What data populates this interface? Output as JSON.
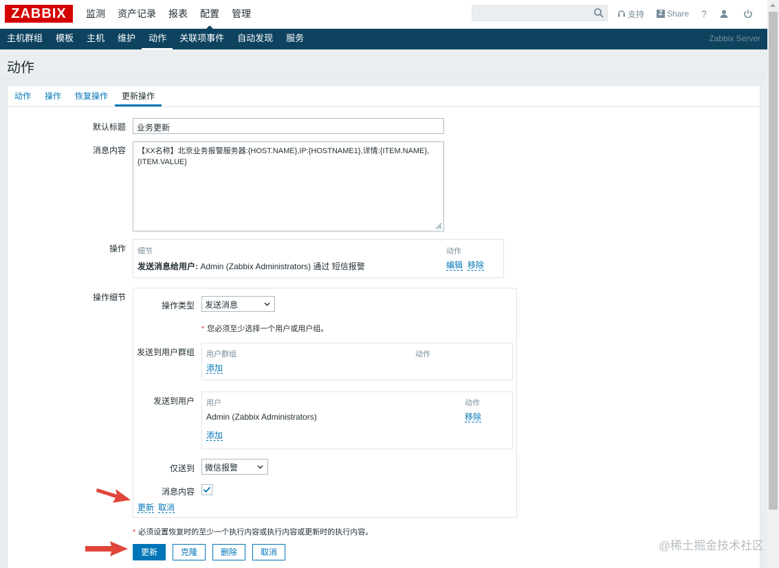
{
  "brand": {
    "logo_text": "ZABBIX",
    "color": "#d40000"
  },
  "main_nav": [
    "监测",
    "资产记录",
    "报表",
    "配置",
    "管理"
  ],
  "main_nav_active": "配置",
  "search": {
    "placeholder": ""
  },
  "top_links": {
    "support": "支持",
    "share": "Share",
    "help": "?"
  },
  "sub_nav": [
    "主机群组",
    "模板",
    "主机",
    "维护",
    "动作",
    "关联项事件",
    "自动发现",
    "服务"
  ],
  "sub_nav_active": "动作",
  "server_name": "Zabbix Server",
  "page_title": "动作",
  "tabs": [
    "动作",
    "操作",
    "恢复操作",
    "更新操作"
  ],
  "tab_active": "更新操作",
  "form": {
    "default_subject_label": "默认标题",
    "default_subject_value": "业务更新",
    "message_label": "消息内容",
    "message_value": "【XX名称】北京业务报警服务器:{HOST.NAME},IP:{HOSTNAME1},详情:{ITEM.NAME},{ITEM.VALUE}",
    "operations_label": "操作",
    "operations_table": {
      "col_detail": "细节",
      "col_action": "动作",
      "row_bold": "发送消息给用户:",
      "row_text": " Admin (Zabbix Administrators) 通过 短信报警",
      "edit": "编辑",
      "remove": "移除"
    },
    "op_details_label": "操作细节",
    "op_type_label": "操作类型",
    "op_type_value": "发送消息",
    "op_type_hint": "您必须至少选择一个用户或用户组。",
    "send_groups_label": "发送到用户群组",
    "groups_table": {
      "col_group": "用户群组",
      "col_action": "动作",
      "add": "添加"
    },
    "send_users_label": "发送到用户",
    "users_table": {
      "col_user": "用户",
      "col_action": "动作",
      "user": "Admin (Zabbix Administrators)",
      "remove": "移除",
      "add": "添加"
    },
    "send_only_label": "仅送到",
    "send_only_value": "微信报警",
    "msg_content_label": "消息内容",
    "msg_content_checked": true,
    "inline_update": "更新",
    "inline_cancel": "取消",
    "footer_hint": "必须设置恢复时的至少一个执行内容或执行内容或更新时的执行内容。",
    "buttons": {
      "update": "更新",
      "clone": "克隆",
      "delete": "删除",
      "cancel": "取消"
    }
  },
  "watermark": "@稀土掘金技术社区",
  "colors": {
    "accent": "#0275b8",
    "subnav_bg": "#0e4360",
    "annotation_arrow": "#e0463a"
  }
}
